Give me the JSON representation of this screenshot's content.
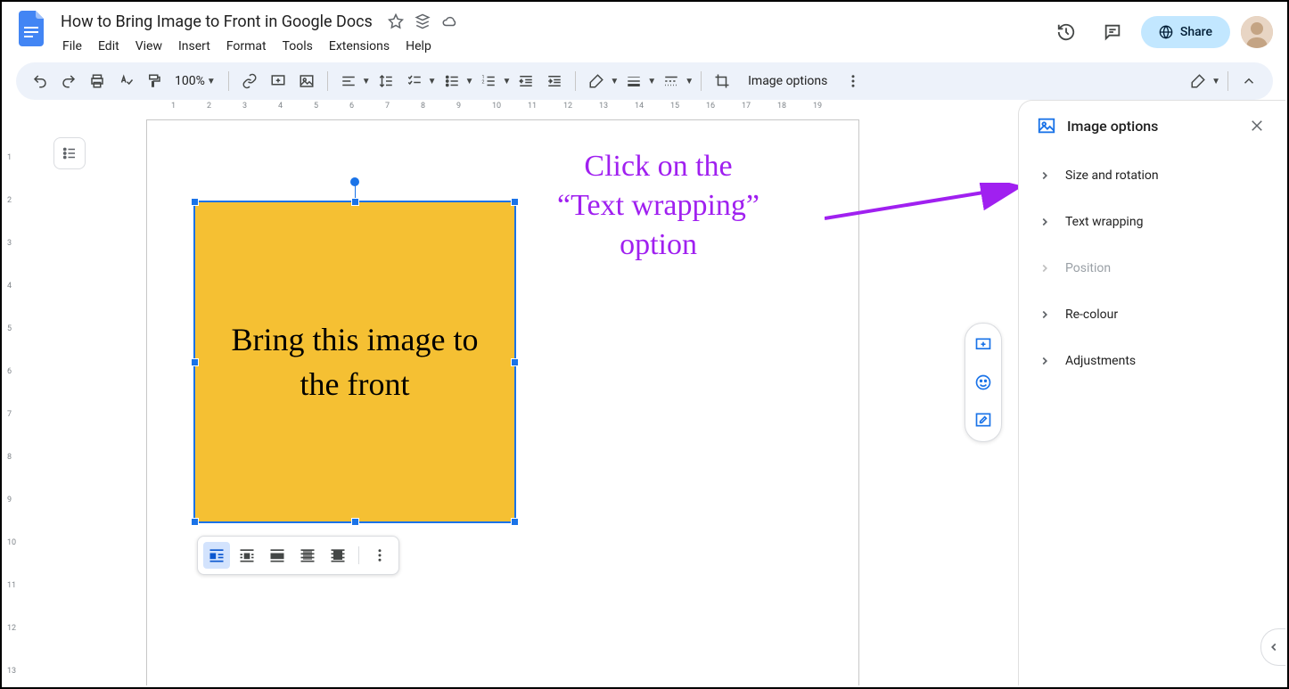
{
  "doc": {
    "title": "How to Bring Image to Front in Google Docs"
  },
  "menus": [
    "File",
    "Edit",
    "View",
    "Insert",
    "Format",
    "Tools",
    "Extensions",
    "Help"
  ],
  "toolbar": {
    "zoom": "100%",
    "image_options_label": "Image options"
  },
  "share_label": "Share",
  "ruler_h": [
    "1",
    "2",
    "3",
    "4",
    "5",
    "6",
    "7",
    "8",
    "9",
    "10",
    "11",
    "12",
    "13",
    "14",
    "15",
    "16",
    "17",
    "18",
    "19"
  ],
  "ruler_v": [
    "1",
    "2",
    "3",
    "4",
    "5",
    "6",
    "7",
    "8",
    "9",
    "10",
    "11",
    "12",
    "13"
  ],
  "image_text": "Bring this image to the front",
  "annotation": {
    "line1": "Click on the",
    "line2": "“Text wrapping”",
    "line3": "option"
  },
  "sidebar": {
    "title": "Image options",
    "items": [
      {
        "label": "Size and rotation",
        "disabled": false
      },
      {
        "label": "Text wrapping",
        "disabled": false
      },
      {
        "label": "Position",
        "disabled": true
      },
      {
        "label": "Re-colour",
        "disabled": false
      },
      {
        "label": "Adjustments",
        "disabled": false
      }
    ]
  }
}
